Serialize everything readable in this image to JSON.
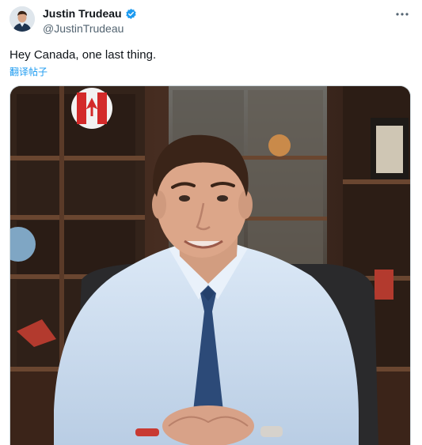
{
  "author": {
    "display_name": "Justin Trudeau",
    "handle": "@JustinTrudeau",
    "verified": true,
    "verified_color": "#1d9bf0"
  },
  "tweet": {
    "text": "Hey Canada, one last thing.",
    "translate_label": "翻译帖子"
  },
  "icons": {
    "verified": "verified-badge-icon",
    "more": "more-options-icon"
  },
  "colors": {
    "link": "#1d9bf0",
    "secondary_text": "#536471"
  }
}
